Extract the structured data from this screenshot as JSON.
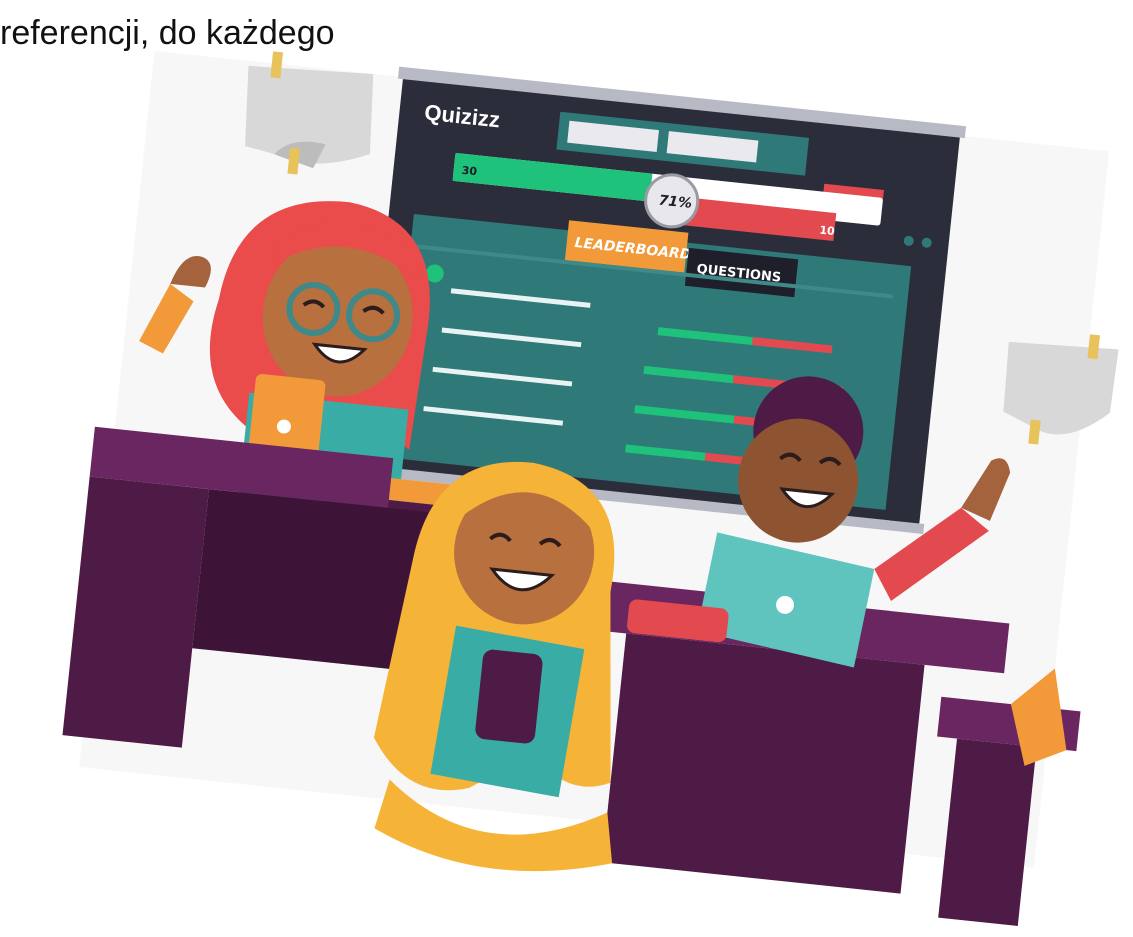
{
  "caption": {
    "text": "referencji, do każdego"
  },
  "illustration": {
    "board": {
      "logo": "Quizizz",
      "progress": {
        "left_value": "30",
        "right_value": "10",
        "percent_label": "71%",
        "fraction": 0.71
      },
      "tabs": {
        "active": "LEADERBOARD",
        "inactive": "QUESTIONS"
      }
    },
    "colors": {
      "board_frame": "#2b2d3b",
      "board_panel": "#2f7a78",
      "progress_green": "#1ec27a",
      "progress_red": "#e24a50",
      "tab_orange": "#f29a3a",
      "tab_dark": "#1e1f2a",
      "desk_purple": "#4e1a46",
      "desk_top": "#6a2660",
      "hair_red": "#ea4b4b",
      "hair_yellow": "#f5b338",
      "skin_brown": "#a4633d",
      "laptop_teal": "#5fc3be"
    }
  }
}
